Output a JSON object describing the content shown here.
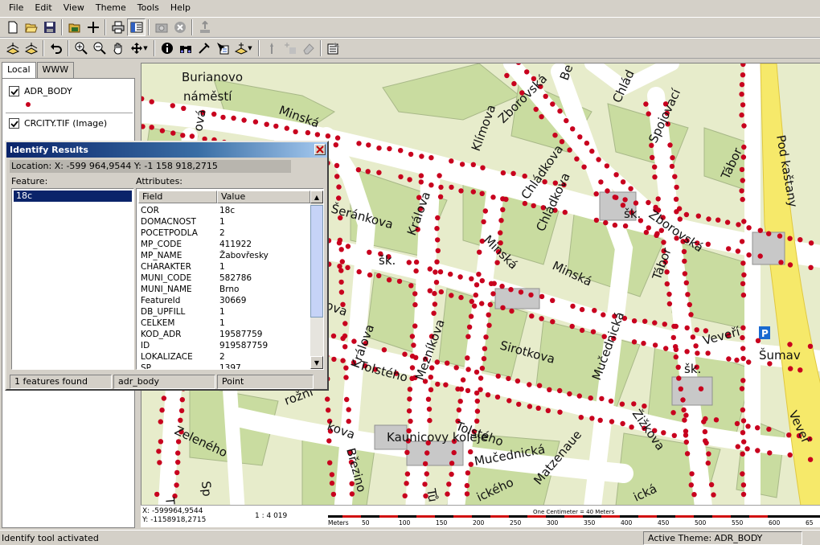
{
  "menu": [
    "File",
    "Edit",
    "View",
    "Theme",
    "Tools",
    "Help"
  ],
  "toolbar1_icons": [
    "new-icon",
    "open-icon",
    "save-icon",
    "open-folder-icon",
    "add-layer-icon",
    "print-icon",
    "toc-icon",
    "camera-icon",
    "cancel-icon",
    "export-icon"
  ],
  "toolbar2_icons": [
    "layer-edit-icon",
    "layer-edit2-icon",
    "undo-icon",
    "zoom-in-icon",
    "zoom-out-icon",
    "pan-icon",
    "full-extent-icon",
    "identify-icon",
    "find-icon",
    "measure-icon",
    "select-icon",
    "select-by-icon",
    "point-icon",
    "add-point-icon",
    "erase-icon",
    "settings-icon"
  ],
  "tabs": {
    "local": "Local",
    "www": "WWW"
  },
  "layers": [
    {
      "name": "ADR_BODY",
      "checked": true
    },
    {
      "name": "CRCITY.TIF (Image)",
      "checked": true
    }
  ],
  "identify": {
    "title": "Identify Results",
    "location": "Location: X: -599 964,9544  Y: -1 158 918,2715",
    "feature_label": "Feature:",
    "attributes_label": "Attributes:",
    "feature_selected": "18c",
    "col_field": "Field",
    "col_value": "Value",
    "rows": [
      {
        "field": "COR",
        "value": "18c"
      },
      {
        "field": "DOMACNOST",
        "value": "1"
      },
      {
        "field": "POCETPODLA",
        "value": "2"
      },
      {
        "field": "MP_CODE",
        "value": "411922"
      },
      {
        "field": "MP_NAME",
        "value": "Žabovřesky"
      },
      {
        "field": "CHARAKTER",
        "value": "1"
      },
      {
        "field": "MUNI_CODE",
        "value": "582786"
      },
      {
        "field": "MUNI_NAME",
        "value": "Brno"
      },
      {
        "field": "FeatureId",
        "value": "30669"
      },
      {
        "field": "DB_UPFILL",
        "value": "1"
      },
      {
        "field": "CELKEM",
        "value": "1"
      },
      {
        "field": "KOD_ADR",
        "value": "19587759"
      },
      {
        "field": "ID",
        "value": "919587759"
      },
      {
        "field": "LOKALIZACE",
        "value": "2"
      },
      {
        "field": "SP",
        "value": "1397"
      }
    ],
    "status_count": "1   features found",
    "status_layer": "adr_body",
    "status_type": "Point"
  },
  "map": {
    "labels": [
      "Burianovo",
      "náměstí",
      "Minská",
      "Zborovská",
      "Klímova",
      "Chládkova",
      "Spojovací",
      "Pod kaštany",
      "Tábor",
      "Zborovská",
      "Chládkova",
      "Králova",
      "Šeránkova",
      "šk.",
      "šk.",
      "Minská",
      "Minská",
      "Tábor",
      "Mučednická",
      "Veveří",
      "Šumav",
      "Králova",
      "Mezníkova",
      "Sirotkova",
      "Tolstého",
      "Tolstého",
      "šk.",
      "Žižkova",
      "Zeleného",
      "Kaunicovy koleje",
      "Mučednická",
      "Matzenaue",
      "Březino",
      "Veveř",
      "Tích",
      "Sp",
      "Tů",
      "ického",
      "ická",
      "ová",
      "rožní",
      "tkova",
      "kova",
      "Be",
      "Chlád"
    ]
  },
  "coords": {
    "x": "X: -599964,9544",
    "y": "Y: -1158918,2715",
    "scale": "1 : 4 019"
  },
  "scale_bar": {
    "title": "One Centimeter = 40 Meters",
    "unit": "Meters",
    "ticks": [
      "50",
      "100",
      "150",
      "200",
      "250",
      "300",
      "350",
      "400",
      "450",
      "500",
      "550",
      "600",
      "65"
    ]
  },
  "status": {
    "left": "Identify tool activated",
    "right": "Active Theme: ADR_BODY"
  },
  "colors": {
    "titlebar": "#0a246a",
    "dot": "#c8001e",
    "street": "#ffffff",
    "block": "#c9dca0",
    "highway": "#f6e96a"
  }
}
